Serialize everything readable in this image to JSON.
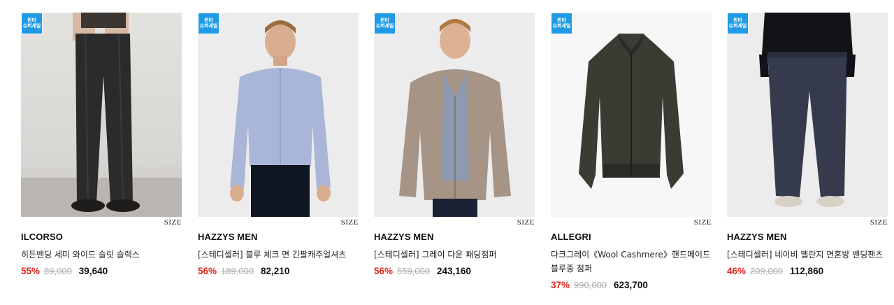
{
  "products": [
    {
      "badge": [
        "윈터",
        "슈퍼세일"
      ],
      "size_label": "SIZE",
      "brand": "ILCORSO",
      "name": "히든밴딩 세미 와이드 슬릿 슬랙스",
      "discount": "55%",
      "original_price": "89,000",
      "sale_price": "39,640"
    },
    {
      "badge": [
        "윈터",
        "슈퍼세일"
      ],
      "size_label": "SIZE",
      "brand": "HAZZYS MEN",
      "name": "[스테디셀러] 블루 체크 면 긴팔캐주얼셔츠",
      "discount": "56%",
      "original_price": "189,000",
      "sale_price": "82,210"
    },
    {
      "badge": [
        "윈터",
        "슈퍼세일"
      ],
      "size_label": "SIZE",
      "brand": "HAZZYS MEN",
      "name": "[스테디셀러] 그레이 다운 패딩점퍼",
      "discount": "56%",
      "original_price": "559,000",
      "sale_price": "243,160"
    },
    {
      "badge": [
        "윈터",
        "슈퍼세일"
      ],
      "size_label": "SIZE",
      "brand": "ALLEGRI",
      "name": "다크그레이《Wool Cashmere》핸드메이드 블루종 점퍼",
      "discount": "37%",
      "original_price": "990,000",
      "sale_price": "623,700"
    },
    {
      "badge": [
        "윈터",
        "슈퍼세일"
      ],
      "size_label": "SIZE",
      "brand": "HAZZYS MEN",
      "name": "[스테디셀러] 네이비 멜란지 면혼방 밴딩팬츠",
      "discount": "46%",
      "original_price": "209,000",
      "sale_price": "112,860"
    }
  ],
  "colors": {
    "badge": "#1f9be6",
    "discount": "#e2261f",
    "original_price": "#aaaaaa"
  }
}
